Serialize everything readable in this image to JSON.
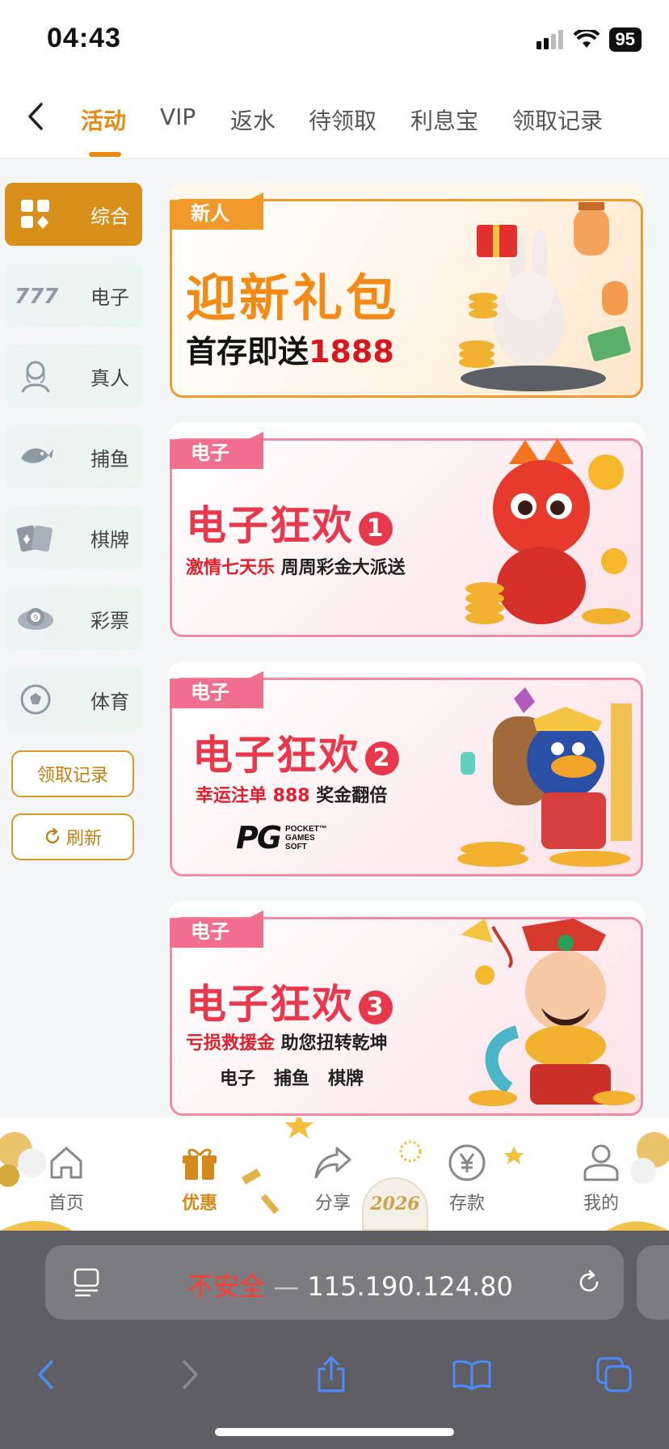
{
  "status": {
    "time": "04:43",
    "battery": "95"
  },
  "top_tabs": [
    {
      "label": "活动",
      "active": true
    },
    {
      "label": "VIP"
    },
    {
      "label": "返水"
    },
    {
      "label": "待领取"
    },
    {
      "label": "利息宝"
    },
    {
      "label": "领取记录"
    }
  ],
  "sidebar": {
    "items": [
      {
        "label": "综合",
        "icon": "grid-icon",
        "active": true
      },
      {
        "label": "电子",
        "icon": "slot-777-icon"
      },
      {
        "label": "真人",
        "icon": "live-dealer-icon"
      },
      {
        "label": "捕鱼",
        "icon": "fish-icon"
      },
      {
        "label": "棋牌",
        "icon": "cards-icon"
      },
      {
        "label": "彩票",
        "icon": "lottery-ball-icon"
      },
      {
        "label": "体育",
        "icon": "soccer-ball-icon"
      }
    ],
    "records_button": "领取记录",
    "refresh_button": "刷新"
  },
  "banners": [
    {
      "tag": "新人",
      "title": "迎新礼包",
      "sub_prefix": "首存即送",
      "sub_highlight": "1888"
    },
    {
      "tag": "电子",
      "title": "电子狂欢",
      "number": "1",
      "sub_red": "激情七天乐",
      "sub_rest": " 周周彩金大派送"
    },
    {
      "tag": "电子",
      "title": "电子狂欢",
      "number": "2",
      "sub_red": "幸运注单 888",
      "sub_rest": " 奖金翻倍",
      "logo_letters": "PG",
      "logo_text_1": "POCKET™",
      "logo_text_2": "GAMES",
      "logo_text_3": "SOFT"
    },
    {
      "tag": "电子",
      "title": "电子狂欢",
      "number": "3",
      "sub_red": "亏损救援金",
      "sub_rest": " 助您扭转乾坤",
      "line3": "电子   捕鱼   棋牌"
    }
  ],
  "bottom_tabs": [
    {
      "label": "首页",
      "icon": "home-icon"
    },
    {
      "label": "优惠",
      "icon": "gift-icon",
      "active": true
    },
    {
      "label": "分享",
      "icon": "share-icon"
    },
    {
      "label": "存款",
      "icon": "yen-coin-icon"
    },
    {
      "label": "我的",
      "icon": "user-icon"
    }
  ],
  "year_badge": "2026",
  "browser": {
    "insecure_label": "不安全",
    "separator": "—",
    "address": "115.190.124.80"
  },
  "colors": {
    "accent": "#e68a12",
    "banner_pink": "#f06f8e",
    "banner_red": "#e8394c"
  }
}
